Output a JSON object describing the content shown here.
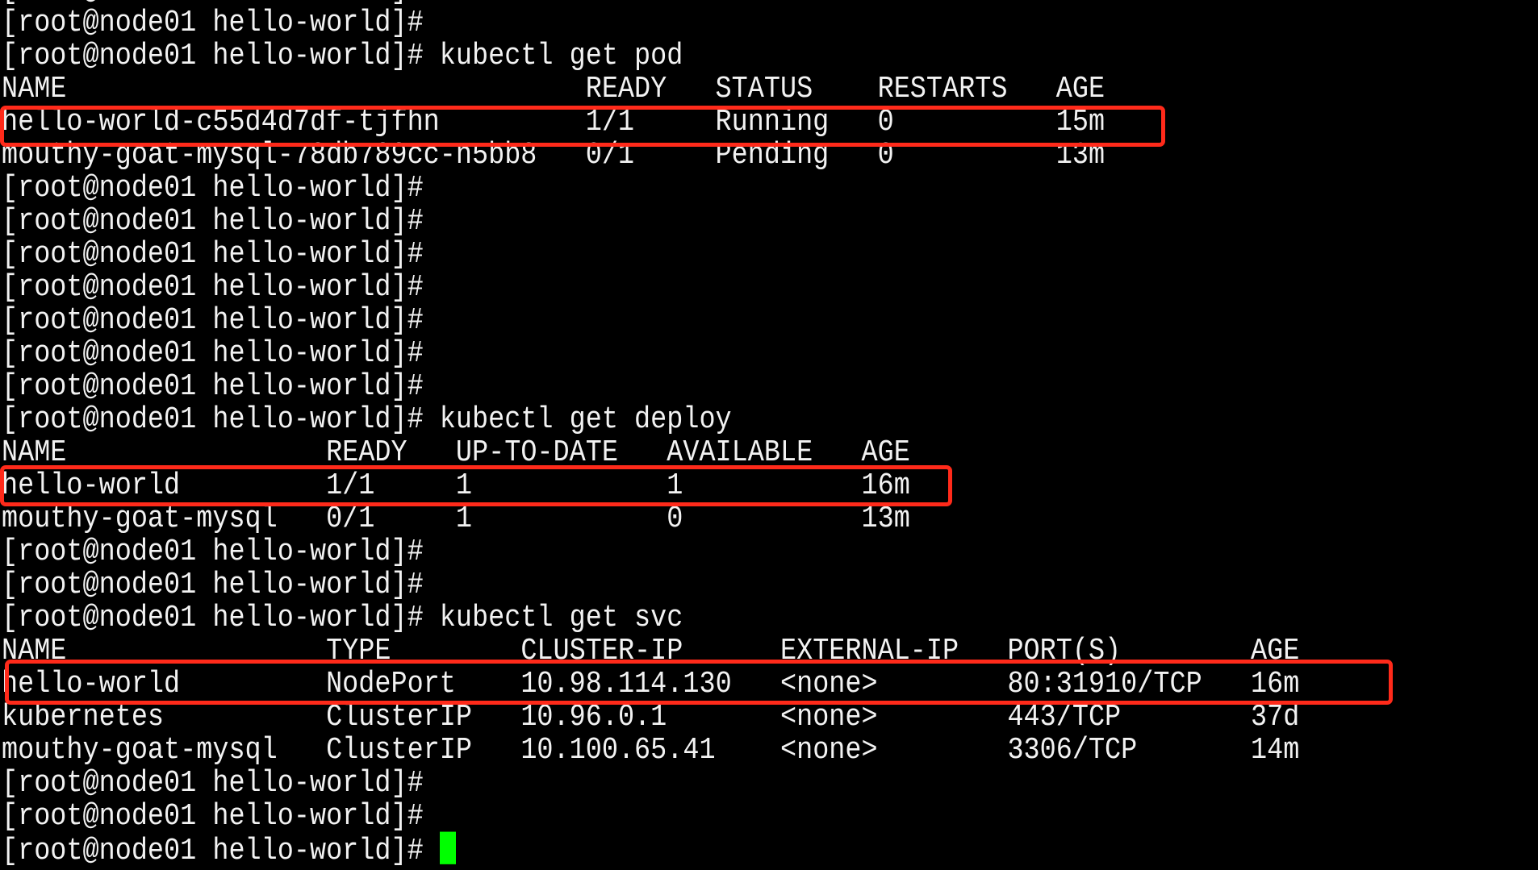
{
  "terminal": {
    "prompt": "[root@node01 hello-world]#",
    "cursor_color": "#00ff00",
    "highlight_color": "#ff2a1a",
    "blocks": [
      {
        "kind": "prompt",
        "command": ""
      },
      {
        "kind": "prompt",
        "command": ""
      },
      {
        "kind": "prompt",
        "command": "kubectl get pod"
      },
      {
        "kind": "table",
        "id": "pod",
        "headers": [
          "NAME",
          "READY",
          "STATUS",
          "RESTARTS",
          "AGE"
        ],
        "rows": [
          {
            "cells": [
              "hello-world-c55d4d7df-tjfhn",
              "1/1",
              "Running",
              "0",
              "15m"
            ],
            "highlighted": true
          },
          {
            "cells": [
              "mouthy-goat-mysql-78db789cc-n5bb8",
              "0/1",
              "Pending",
              "0",
              "13m"
            ],
            "highlighted": false
          }
        ]
      },
      {
        "kind": "prompt",
        "command": ""
      },
      {
        "kind": "prompt",
        "command": ""
      },
      {
        "kind": "prompt",
        "command": ""
      },
      {
        "kind": "prompt",
        "command": ""
      },
      {
        "kind": "prompt",
        "command": ""
      },
      {
        "kind": "prompt",
        "command": ""
      },
      {
        "kind": "prompt",
        "command": ""
      },
      {
        "kind": "prompt",
        "command": "kubectl get deploy"
      },
      {
        "kind": "table",
        "id": "deploy",
        "headers": [
          "NAME",
          "READY",
          "UP-TO-DATE",
          "AVAILABLE",
          "AGE"
        ],
        "rows": [
          {
            "cells": [
              "hello-world",
              "1/1",
              "1",
              "1",
              "16m"
            ],
            "highlighted": true
          },
          {
            "cells": [
              "mouthy-goat-mysql",
              "0/1",
              "1",
              "0",
              "13m"
            ],
            "highlighted": false
          }
        ]
      },
      {
        "kind": "prompt",
        "command": ""
      },
      {
        "kind": "prompt",
        "command": ""
      },
      {
        "kind": "prompt",
        "command": "kubectl get svc"
      },
      {
        "kind": "table",
        "id": "svc",
        "headers": [
          "NAME",
          "TYPE",
          "CLUSTER-IP",
          "EXTERNAL-IP",
          "PORT(S)",
          "AGE"
        ],
        "rows": [
          {
            "cells": [
              "hello-world",
              "NodePort",
              "10.98.114.130",
              "<none>",
              "80:31910/TCP",
              "16m"
            ],
            "highlighted": true
          },
          {
            "cells": [
              "kubernetes",
              "ClusterIP",
              "10.96.0.1",
              "<none>",
              "443/TCP",
              "37d"
            ],
            "highlighted": false
          },
          {
            "cells": [
              "mouthy-goat-mysql",
              "ClusterIP",
              "10.100.65.41",
              "<none>",
              "3306/TCP",
              "14m"
            ],
            "highlighted": false
          }
        ]
      },
      {
        "kind": "prompt",
        "command": ""
      },
      {
        "kind": "prompt",
        "command": ""
      },
      {
        "kind": "prompt",
        "command": "",
        "cursor": true
      }
    ]
  }
}
